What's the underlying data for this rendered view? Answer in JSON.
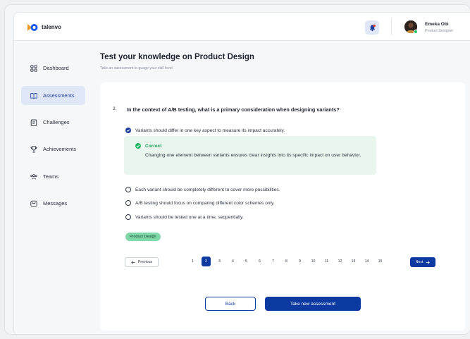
{
  "brand": {
    "name": "talenvo",
    "colors": {
      "blue": "#1a5cf0",
      "orange": "#f39a24"
    }
  },
  "header": {
    "notification_icon": "bell-icon",
    "user": {
      "name": "Emeka Obi",
      "role": "Product Designer"
    }
  },
  "sidebar": {
    "items": [
      {
        "label": "Dashboard",
        "icon": "grid-icon",
        "active": false
      },
      {
        "label": "Assessments",
        "icon": "book-icon",
        "active": true
      },
      {
        "label": "Challenges",
        "icon": "clipboard-icon",
        "active": false
      },
      {
        "label": "Achievements",
        "icon": "trophy-icon",
        "active": false
      },
      {
        "label": "Teams",
        "icon": "users-icon",
        "active": false
      },
      {
        "label": "Messages",
        "icon": "message-icon",
        "active": false
      }
    ]
  },
  "page": {
    "title": "Test your knowledge on Product Design",
    "subtitle": "Take an assessment to guage your skill level"
  },
  "question": {
    "number": "2.",
    "text": "In the context of A/B testing, what is a primary consideration when designing variants?",
    "options": [
      {
        "text": "Variants should differ in one key aspect to measure its impact accurately.",
        "selected": true
      },
      {
        "text": "Each variant should be completely different to cover more possibilities.",
        "selected": false
      },
      {
        "text": "A/B testing should focus on comparing different color schemes only.",
        "selected": false
      },
      {
        "text": "Variants should be tested one at a time, sequentially.",
        "selected": false
      }
    ],
    "feedback": {
      "status": "Correct",
      "explanation": "Changing one element between variants ensures clear insights into its specific impact on user behavior."
    },
    "tag": "Product Design"
  },
  "pagination": {
    "previous_label": "Previous",
    "next_label": "Next",
    "pages": [
      "1",
      "2",
      "3",
      "4",
      "5",
      "6",
      "7",
      "8",
      "9",
      "10",
      "11",
      "12",
      "13",
      "14",
      "15"
    ],
    "current": "2"
  },
  "actions": {
    "back_label": "Back",
    "new_label": "Take new assessment"
  }
}
